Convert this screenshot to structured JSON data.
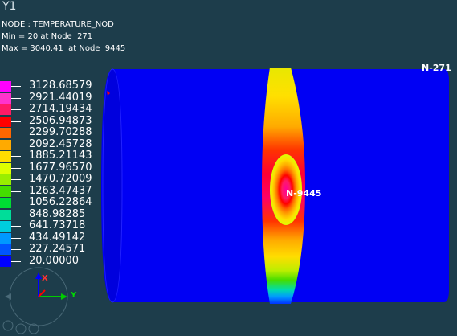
{
  "view": {
    "title": "Y1"
  },
  "result_info": {
    "line1": "NODE : TEMPERATURE_NOD",
    "line2": "Min = 20 at Node  271",
    "line3": "Max = 3040.41  at Node  9445"
  },
  "legend": {
    "entries": [
      {
        "value": "3128.68579",
        "color": "#ff00ff"
      },
      {
        "value": "2921.44019",
        "color": "#ff33cc"
      },
      {
        "value": "2714.19434",
        "color": "#ff1a66"
      },
      {
        "value": "2506.94873",
        "color": "#ff0000"
      },
      {
        "value": "2299.70288",
        "color": "#ff6600"
      },
      {
        "value": "2092.45728",
        "color": "#ffaa00"
      },
      {
        "value": "1885.21143",
        "color": "#ffdd00"
      },
      {
        "value": "1677.96570",
        "color": "#ddff00"
      },
      {
        "value": "1470.72009",
        "color": "#99ee00"
      },
      {
        "value": "1263.47437",
        "color": "#44dd00"
      },
      {
        "value": "1056.22864",
        "color": "#00dd33"
      },
      {
        "value": "848.98285",
        "color": "#00dd99"
      },
      {
        "value": "641.73718",
        "color": "#00ccdd"
      },
      {
        "value": "434.49142",
        "color": "#0099ff"
      },
      {
        "value": "227.24571",
        "color": "#0055ff"
      },
      {
        "value": "20.00000",
        "color": "#0000ff"
      }
    ]
  },
  "nodes": {
    "max_label": "N-9445",
    "min_label": "N-271"
  },
  "triad": {
    "x": "X",
    "y": "Y"
  }
}
